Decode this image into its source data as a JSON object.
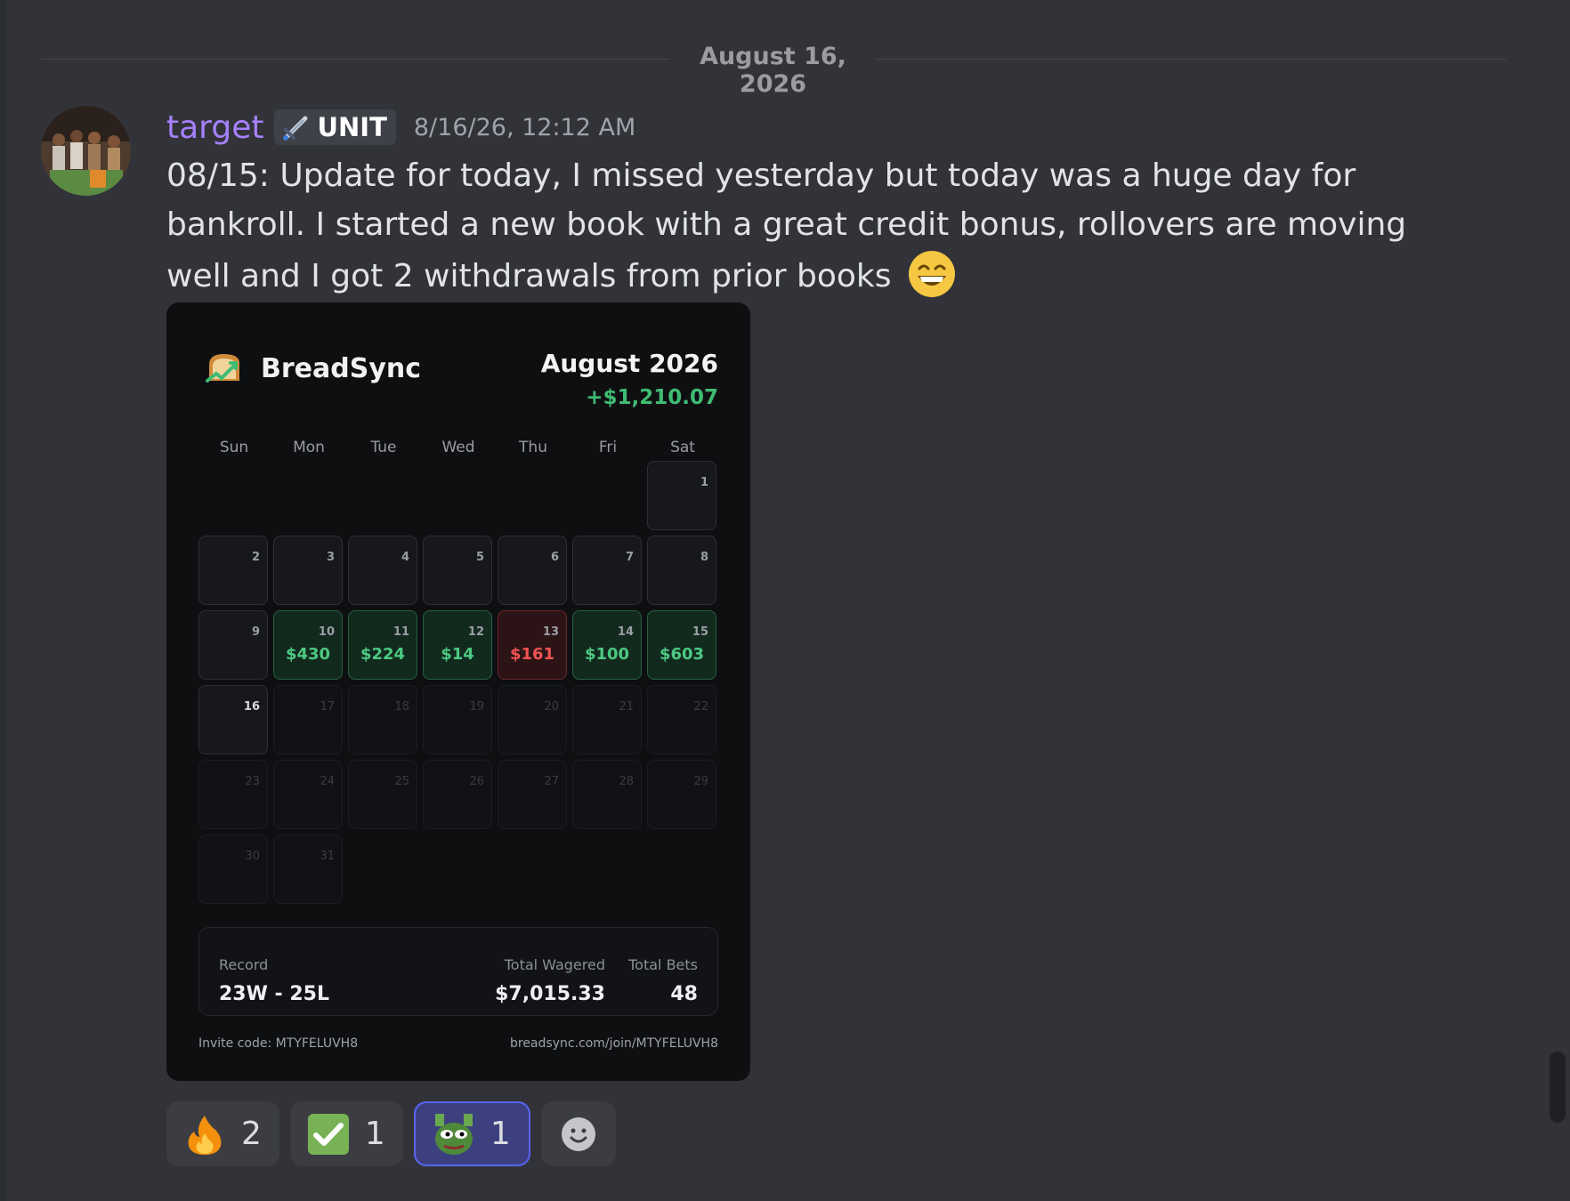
{
  "date_divider": "August 16, 2026",
  "message": {
    "username": "target",
    "role": {
      "name": "UNIT",
      "icon": "sword-icon"
    },
    "timestamp": "8/16/26, 12:12 AM",
    "text": "08/15: Update for today, I missed yesterday but today was a huge day for bankroll. I started a new book with a great credit bonus, rollovers are moving well and I got 2 withdrawals from prior books",
    "emoji": "grinning-face-icon"
  },
  "card": {
    "brand": "BreadSync",
    "month": "August 2026",
    "month_total": "+$1,210.07",
    "weekdays": [
      "Sun",
      "Mon",
      "Tue",
      "Wed",
      "Thu",
      "Fri",
      "Sat"
    ],
    "days": [
      {
        "d": "1"
      },
      {
        "d": "2"
      },
      {
        "d": "3"
      },
      {
        "d": "4"
      },
      {
        "d": "5"
      },
      {
        "d": "6"
      },
      {
        "d": "7"
      },
      {
        "d": "8"
      },
      {
        "d": "9"
      },
      {
        "d": "10",
        "amount": "$430",
        "result": "win"
      },
      {
        "d": "11",
        "amount": "$224",
        "result": "win"
      },
      {
        "d": "12",
        "amount": "$14",
        "result": "win"
      },
      {
        "d": "13",
        "amount": "$161",
        "result": "loss"
      },
      {
        "d": "14",
        "amount": "$100",
        "result": "win"
      },
      {
        "d": "15",
        "amount": "$603",
        "result": "win"
      },
      {
        "d": "16",
        "today": true
      },
      {
        "d": "17",
        "future": true
      },
      {
        "d": "18",
        "future": true
      },
      {
        "d": "19",
        "future": true
      },
      {
        "d": "20",
        "future": true
      },
      {
        "d": "21",
        "future": true
      },
      {
        "d": "22",
        "future": true
      },
      {
        "d": "23",
        "future": true
      },
      {
        "d": "24",
        "future": true
      },
      {
        "d": "25",
        "future": true
      },
      {
        "d": "26",
        "future": true
      },
      {
        "d": "27",
        "future": true
      },
      {
        "d": "28",
        "future": true
      },
      {
        "d": "29",
        "future": true
      },
      {
        "d": "30",
        "future": true
      },
      {
        "d": "31",
        "future": true
      }
    ],
    "summary": {
      "record_label": "Record",
      "record_value": "23W - 25L",
      "wagered_label": "Total Wagered",
      "wagered_value": "$7,015.33",
      "bets_label": "Total Bets",
      "bets_value": "48"
    },
    "invite_code": "Invite code: MTYFELUVH8",
    "join_url": "breadsync.com/join/MTYFELUVH8"
  },
  "reactions": [
    {
      "icon": "fire-icon",
      "count": "2"
    },
    {
      "icon": "check-mark-icon",
      "count": "1"
    },
    {
      "icon": "pepe-icon",
      "count": "1",
      "me": true
    }
  ],
  "add_reaction_icon": "add-reaction-icon"
}
